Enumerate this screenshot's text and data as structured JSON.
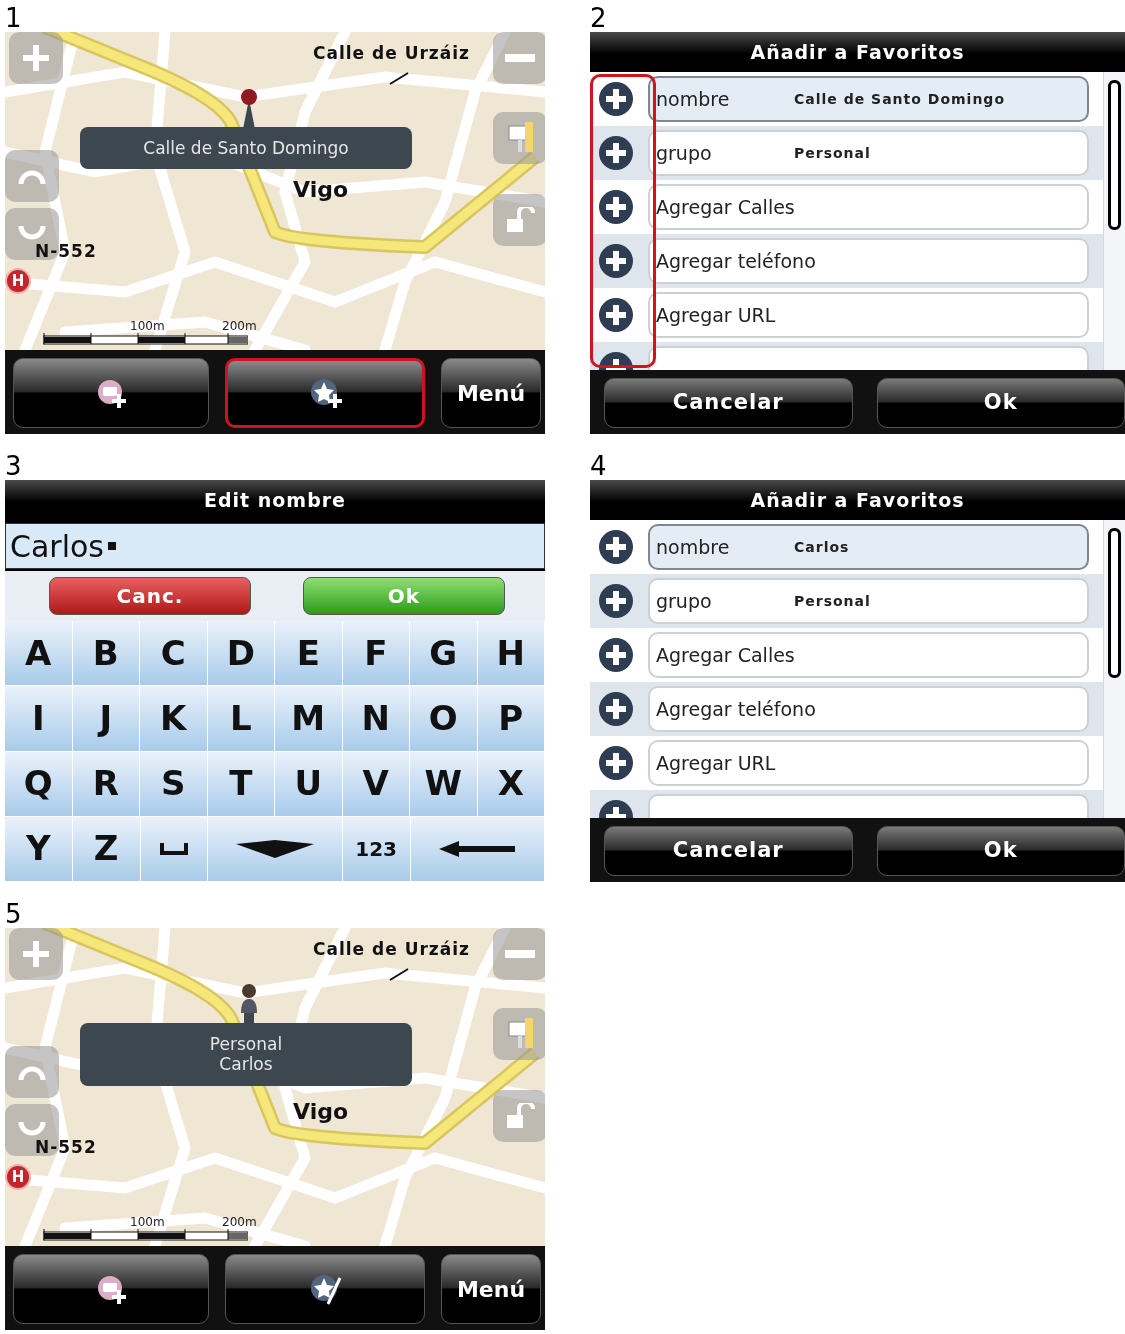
{
  "screens": [
    {
      "number": "1",
      "kind": "map",
      "street_label": "Calle de Urzáiz",
      "city_label": "Vigo",
      "road_label": "N-552",
      "poi_label": "H",
      "marker": {
        "kind": "pin"
      },
      "popup_lines": [
        "Calle de Santo Domingo"
      ],
      "scale_labels": [
        "100m",
        "200m"
      ],
      "toolbar": [
        {
          "kind": "poi-add",
          "highlighted": false
        },
        {
          "kind": "favorite-add",
          "highlighted": true
        },
        {
          "kind": "text",
          "label": "Menú",
          "highlighted": false
        }
      ]
    },
    {
      "number": "2",
      "kind": "form",
      "title": "Añadir a Favoritos",
      "icons_highlighted": true,
      "rows": [
        {
          "kind": "field",
          "label": "nombre",
          "value": "Calle de Santo Domingo",
          "selected": true
        },
        {
          "kind": "field",
          "label": "grupo",
          "value": "Personal",
          "selected": false
        },
        {
          "kind": "field",
          "label": "Agregar Calles",
          "selected": false
        },
        {
          "kind": "field",
          "label": "Agregar teléfono",
          "selected": false
        },
        {
          "kind": "field",
          "label": "Agregar URL",
          "selected": false
        },
        {
          "kind": "partial",
          "selected": false
        }
      ],
      "buttons": [
        "Cancelar",
        "Ok"
      ]
    },
    {
      "number": "3",
      "kind": "keyboard",
      "title": "Edit nombre",
      "value": "Carlos",
      "cancel": "Canc.",
      "ok": "Ok",
      "keys": [
        [
          {
            "kind": "letter",
            "label": "A"
          },
          {
            "kind": "letter",
            "label": "B"
          },
          {
            "kind": "letter",
            "label": "C"
          },
          {
            "kind": "letter",
            "label": "D"
          },
          {
            "kind": "letter",
            "label": "E"
          },
          {
            "kind": "letter",
            "label": "F"
          },
          {
            "kind": "letter",
            "label": "G"
          },
          {
            "kind": "letter",
            "label": "H"
          }
        ],
        [
          {
            "kind": "letter",
            "label": "I"
          },
          {
            "kind": "letter",
            "label": "J"
          },
          {
            "kind": "letter",
            "label": "K"
          },
          {
            "kind": "letter",
            "label": "L"
          },
          {
            "kind": "letter",
            "label": "M"
          },
          {
            "kind": "letter",
            "label": "N"
          },
          {
            "kind": "letter",
            "label": "O"
          },
          {
            "kind": "letter",
            "label": "P"
          }
        ],
        [
          {
            "kind": "letter",
            "label": "Q"
          },
          {
            "kind": "letter",
            "label": "R"
          },
          {
            "kind": "letter",
            "label": "S"
          },
          {
            "kind": "letter",
            "label": "T"
          },
          {
            "kind": "letter",
            "label": "U"
          },
          {
            "kind": "letter",
            "label": "V"
          },
          {
            "kind": "letter",
            "label": "W"
          },
          {
            "kind": "letter",
            "label": "X"
          }
        ],
        [
          {
            "kind": "letter",
            "label": "Y"
          },
          {
            "kind": "letter",
            "label": "Z"
          },
          {
            "kind": "space"
          },
          {
            "kind": "hide"
          },
          {
            "kind": "digits",
            "label": "123"
          },
          {
            "kind": "backspace"
          }
        ]
      ]
    },
    {
      "number": "4",
      "kind": "form",
      "title": "Añadir a Favoritos",
      "icons_highlighted": false,
      "rows": [
        {
          "kind": "field",
          "label": "nombre",
          "value": "Carlos",
          "selected": true
        },
        {
          "kind": "field",
          "label": "grupo",
          "value": "Personal",
          "selected": false
        },
        {
          "kind": "field",
          "label": "Agregar Calles",
          "selected": false
        },
        {
          "kind": "field",
          "label": "Agregar teléfono",
          "selected": false
        },
        {
          "kind": "field",
          "label": "Agregar URL",
          "selected": false
        },
        {
          "kind": "partial",
          "selected": false
        }
      ],
      "buttons": [
        "Cancelar",
        "Ok"
      ]
    },
    {
      "number": "5",
      "kind": "map",
      "street_label": "Calle de Urzáiz",
      "city_label": "Vigo",
      "road_label": "N-552",
      "poi_label": "H",
      "marker": {
        "kind": "person"
      },
      "popup_lines": [
        "Personal",
        "Carlos"
      ],
      "scale_labels": [
        "100m",
        "200m"
      ],
      "toolbar": [
        {
          "kind": "poi-add",
          "highlighted": false
        },
        {
          "kind": "favorite-edit",
          "highlighted": false
        },
        {
          "kind": "text",
          "label": "Menú",
          "highlighted": false
        }
      ]
    }
  ]
}
